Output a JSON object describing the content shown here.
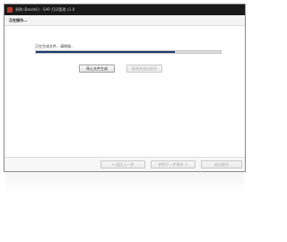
{
  "window": {
    "title": "易购 (Bosdeli) - SAR 打印管理 v1.0"
  },
  "header": {
    "title": "正在操作..."
  },
  "progress": {
    "label": "正在生成文件，请稍候...",
    "value": 0.75,
    "fill_color": "#1d3a6b"
  },
  "actions": {
    "stop_label": "停止文件生成",
    "cancel_label": "取消并退出程序"
  },
  "footer": {
    "back_label": "< 返回上一步",
    "next_label": "转到下一步操作 >",
    "finish_label": "退出程序"
  }
}
